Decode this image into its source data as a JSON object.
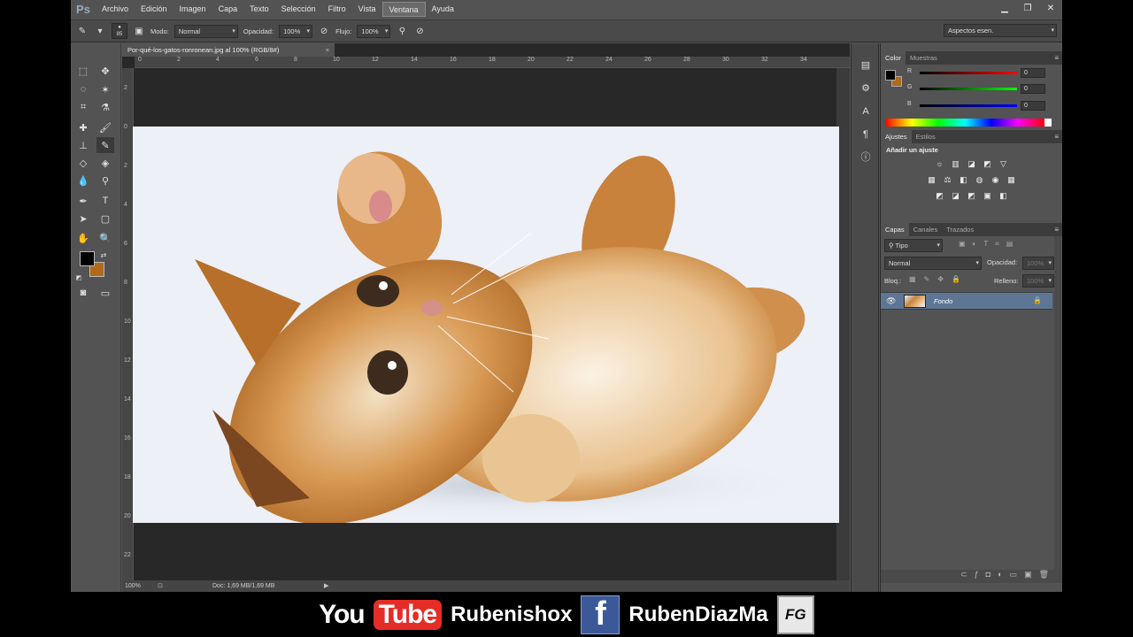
{
  "menubar": {
    "logo": "Ps",
    "items": [
      "Archivo",
      "Edición",
      "Imagen",
      "Capa",
      "Texto",
      "Selección",
      "Filtro",
      "Vista",
      "Ventana",
      "Ayuda"
    ],
    "active_item": "Ventana",
    "window_controls": [
      "minimize-icon",
      "restore-icon",
      "close-icon"
    ]
  },
  "options": {
    "brush_size": "85",
    "mode_label": "Modo:",
    "mode_value": "Normal",
    "opacity_label": "Opacidad:",
    "opacity_value": "100%",
    "flow_label": "Flujo:",
    "flow_value": "100%",
    "workspace": "Aspectos esen."
  },
  "document": {
    "tab_title": "Por-qué-los-gatos-ronronean.jpg al 100% (RGB/8#)",
    "ruler_h": [
      "0",
      "2",
      "4",
      "6",
      "8",
      "10",
      "12",
      "14",
      "16",
      "18",
      "20",
      "22",
      "24",
      "26",
      "28",
      "30",
      "32",
      "34"
    ],
    "ruler_v": [
      "2",
      "0",
      "2",
      "4",
      "6",
      "8",
      "10",
      "12",
      "14",
      "16",
      "18",
      "20",
      "22"
    ],
    "zoom": "100%",
    "doc_size": "Doc: 1,69 MB/1,69 MB"
  },
  "color_panel": {
    "tabs": [
      "Color",
      "Muestras"
    ],
    "channels": [
      {
        "label": "R",
        "value": "0",
        "color": "#d22"
      },
      {
        "label": "G",
        "value": "0",
        "color": "#2c2"
      },
      {
        "label": "B",
        "value": "0",
        "color": "#33d"
      }
    ],
    "foreground": "#000000",
    "background": "#b06a1a"
  },
  "adjustments_panel": {
    "tabs": [
      "Ajustes",
      "Estilos"
    ],
    "heading": "Añadir un ajuste",
    "row1": [
      "☼",
      "▥",
      "◪",
      "◩",
      "▽"
    ],
    "row2": [
      "▦",
      "⚖",
      "◧",
      "◍",
      "◉",
      "▦"
    ],
    "row3": [
      "◩",
      "◪",
      "◩",
      "▣",
      "◧"
    ]
  },
  "layers_panel": {
    "tabs": [
      "Capas",
      "Canales",
      "Trazados"
    ],
    "filter": "Tipo",
    "blend": "Normal",
    "opacity_label": "Opacidad:",
    "opacity_value": "100%",
    "lock_label": "Bloq.:",
    "fill_label": "Relleno:",
    "fill_value": "100%",
    "layer_name": "Fondo"
  },
  "footer": {
    "yt_you": "You",
    "yt_tube": "Tube",
    "yt_channel": "Rubenishox",
    "fb_letter": "f",
    "fb_name": "RubenDiazMa",
    "fg_logo": "FG"
  }
}
